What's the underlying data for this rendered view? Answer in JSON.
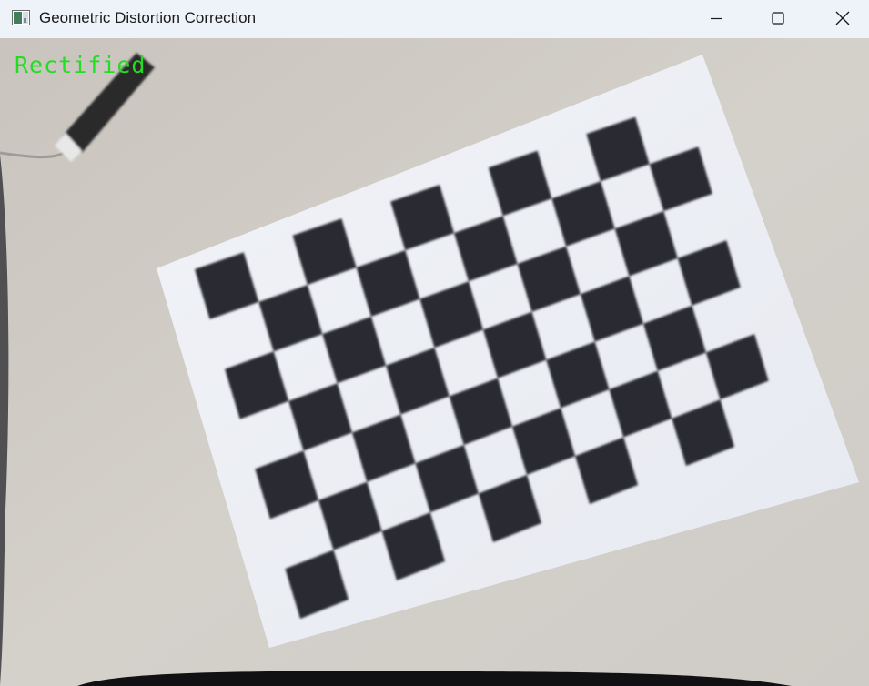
{
  "window": {
    "title": "Geometric Distortion Correction",
    "icon": "opencv-window-icon",
    "controls": [
      "minimize-icon",
      "maximize-icon",
      "close-icon"
    ]
  },
  "frame": {
    "overlay_text": "Rectified",
    "overlay_color": "#22dd22",
    "scene": "checkerboard-calibration-pattern",
    "pattern": {
      "inner_grid": "6x9"
    }
  },
  "colors": {
    "titlebar_bg": "#eef3f9",
    "desk": "#cfcac3",
    "paper": "#eef0f5",
    "square": "#2a2a30"
  }
}
